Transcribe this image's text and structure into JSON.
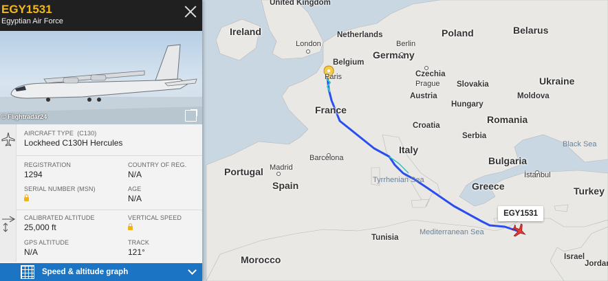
{
  "flight": {
    "callsign": "EGY1531",
    "airline": "Egyptian Air Force",
    "photo_credit": "© Flightradar24",
    "close_label": "×",
    "aircraft_type_key": "AIRCRAFT TYPE",
    "aircraft_type_code": "(C130)",
    "aircraft_type_value": "Lockheed C130H Hercules",
    "registration_key": "REGISTRATION",
    "registration_value": "1294",
    "country_key": "COUNTRY OF REG.",
    "country_value": "N/A",
    "serial_key": "SERIAL NUMBER (MSN)",
    "age_key": "AGE",
    "age_value": "N/A",
    "cal_alt_key": "CALIBRATED ALTITUDE",
    "cal_alt_value": "25,000 ft",
    "vspeed_key": "VERTICAL SPEED",
    "gps_alt_key": "GPS ALTITUDE",
    "gps_alt_value": "N/A",
    "track_key": "TRACK",
    "track_value": "121°"
  },
  "graph_bar": {
    "label": "Speed & altitude graph"
  },
  "map": {
    "flight_tag": "EGY1531",
    "countries": {
      "uk": "United Kingdom",
      "ireland": "Ireland",
      "netherlands": "Netherlands",
      "poland": "Poland",
      "belarus": "Belarus",
      "germany": "Germany",
      "belgium": "Belgium",
      "czechia": "Czechia",
      "slovakia": "Slovakia",
      "ukraine": "Ukraine",
      "austria": "Austria",
      "hungary": "Hungary",
      "moldova": "Moldova",
      "france": "France",
      "romania": "Romania",
      "croatia": "Croatia",
      "serbia": "Serbia",
      "italy": "Italy",
      "bulgaria": "Bulgaria",
      "portugal": "Portugal",
      "spain": "Spain",
      "greece": "Greece",
      "turkey": "Turkey",
      "tunisia": "Tunisia",
      "morocco": "Morocco",
      "israel": "Israel",
      "jordan": "Jordan"
    },
    "cities": {
      "london": "London",
      "berlin": "Berlin",
      "paris": "Paris",
      "prague": "Prague",
      "barcelona": "Barcelona",
      "madrid": "Madrid",
      "istanbul": "İstanbul"
    },
    "seas": {
      "black": "Black Sea",
      "tyrrhenian": "Tyrrhenian Sea",
      "mediterranean": "Mediterranean Sea"
    }
  },
  "colors": {
    "track": "#2a4df0",
    "accent": "#f6b818",
    "graph_bar": "#1c74c4",
    "sea": "#c9d7e3",
    "land": "#e9e8e4"
  },
  "icons": {
    "close": "close-icon",
    "expand": "expand-icon",
    "aircraft_type": "airplane-icon",
    "altitude": "airplane-altitude-icon",
    "graph": "grid-chart-icon",
    "chevron": "chevron-down-icon",
    "origin": "map-pin-icon",
    "plane": "aircraft-icon"
  }
}
